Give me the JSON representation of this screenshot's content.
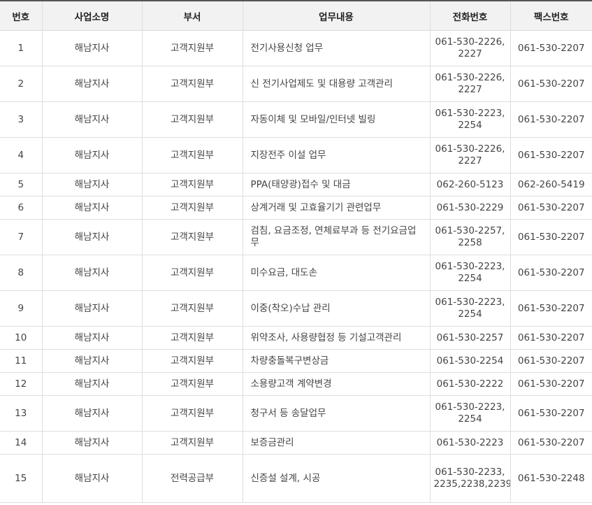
{
  "table": {
    "headers": [
      "번호",
      "사업소명",
      "부서",
      "업무내용",
      "전화번호",
      "팩스번호"
    ],
    "rows": [
      {
        "no": "1",
        "office": "해남지사",
        "dept": "고객지원부",
        "work": "전기사용신청 업무",
        "tel": "061-530-2226, 2227",
        "fax": "061-530-2207"
      },
      {
        "no": "2",
        "office": "해남지사",
        "dept": "고객지원부",
        "work": "신 전기사업제도 및 대용량 고객관리",
        "tel": "061-530-2226, 2227",
        "fax": "061-530-2207"
      },
      {
        "no": "3",
        "office": "해남지사",
        "dept": "고객지원부",
        "work": "자동이체 및 모바일/인터넷 빌링",
        "tel": "061-530-2223, 2254",
        "fax": "061-530-2207"
      },
      {
        "no": "4",
        "office": "해남지사",
        "dept": "고객지원부",
        "work": "지장전주 이설 업무",
        "tel": "061-530-2226, 2227",
        "fax": "061-530-2207"
      },
      {
        "no": "5",
        "office": "해남지사",
        "dept": "고객지원부",
        "work": "PPA(태양광)접수 및 대금",
        "tel": "062-260-5123",
        "fax": "062-260-5419"
      },
      {
        "no": "6",
        "office": "해남지사",
        "dept": "고객지원부",
        "work": "상계거래 및 고효율기기 관련업무",
        "tel": "061-530-2229",
        "fax": "061-530-2207"
      },
      {
        "no": "7",
        "office": "해남지사",
        "dept": "고객지원부",
        "work": "검침, 요금조정, 연체료부과 등 전기요금업무",
        "tel": "061-530-2257, 2258",
        "fax": "061-530-2207"
      },
      {
        "no": "8",
        "office": "해남지사",
        "dept": "고객지원부",
        "work": "미수요금, 대도손",
        "tel": "061-530-2223, 2254",
        "fax": "061-530-2207"
      },
      {
        "no": "9",
        "office": "해남지사",
        "dept": "고객지원부",
        "work": "이중(착오)수납 관리",
        "tel": "061-530-2223, 2254",
        "fax": "061-530-2207"
      },
      {
        "no": "10",
        "office": "해남지사",
        "dept": "고객지원부",
        "work": "위약조사, 사용량협정 등 기설고객관리",
        "tel": "061-530-2257",
        "fax": "061-530-2207"
      },
      {
        "no": "11",
        "office": "해남지사",
        "dept": "고객지원부",
        "work": "차량충돌복구변상금",
        "tel": "061-530-2254",
        "fax": "061-530-2207"
      },
      {
        "no": "12",
        "office": "해남지사",
        "dept": "고객지원부",
        "work": "소용량고객 계약변경",
        "tel": "061-530-2222",
        "fax": "061-530-2207"
      },
      {
        "no": "13",
        "office": "해남지사",
        "dept": "고객지원부",
        "work": "청구서 등 송달업무",
        "tel": "061-530-2223, 2254",
        "fax": "061-530-2207"
      },
      {
        "no": "14",
        "office": "해남지사",
        "dept": "고객지원부",
        "work": "보증금관리",
        "tel": "061-530-2223",
        "fax": "061-530-2207"
      },
      {
        "no": "15",
        "office": "해남지사",
        "dept": "전력공급부",
        "work": "신증설 설계, 시공",
        "tel": "061-530-2233, 2235,2238,2239",
        "fax": "061-530-2248"
      }
    ]
  }
}
